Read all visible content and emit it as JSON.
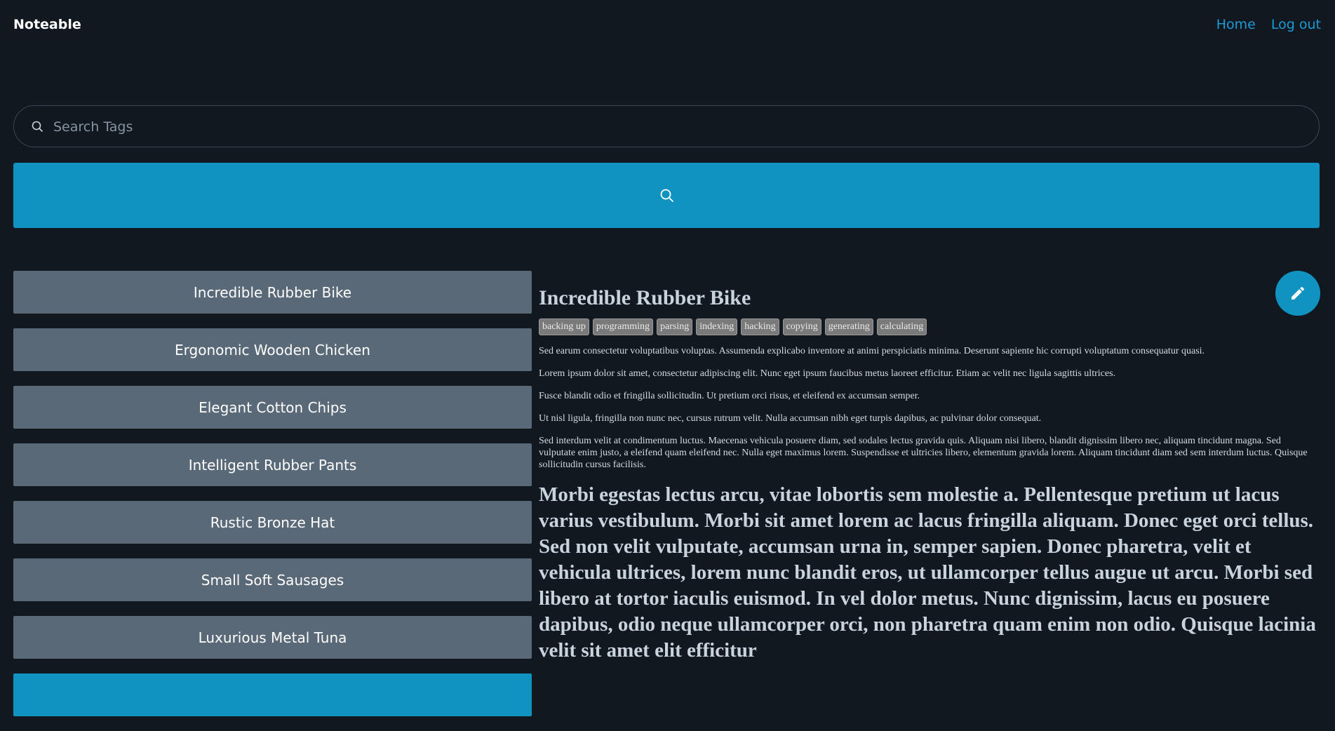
{
  "nav": {
    "brand": "Noteable",
    "home": "Home",
    "logout": "Log out"
  },
  "search": {
    "placeholder": "Search Tags",
    "value": ""
  },
  "notes": [
    "Incredible Rubber Bike",
    "Ergonomic Wooden Chicken",
    "Elegant Cotton Chips",
    "Intelligent Rubber Pants",
    "Rustic Bronze Hat",
    "Small Soft Sausages",
    "Luxurious Metal Tuna"
  ],
  "note": {
    "title": "Incredible Rubber Bike",
    "tags": [
      "backing up",
      "programming",
      "parsing",
      "indexing",
      "hacking",
      "copying",
      "generating",
      "calculating"
    ],
    "paragraphs": [
      "Sed earum consectetur voluptatibus voluptas. Assumenda explicabo inventore at animi perspiciatis minima. Deserunt sapiente hic corrupti voluptatum consequatur quasi.",
      "Lorem ipsum dolor sit amet, consectetur adipiscing elit. Nunc eget ipsum faucibus metus laoreet efficitur. Etiam ac velit nec ligula sagittis ultrices.",
      "Fusce blandit odio et fringilla sollicitudin. Ut pretium orci risus, et eleifend ex accumsan semper.",
      "Ut nisl ligula, fringilla non nunc nec, cursus rutrum velit. Nulla accumsan nibh eget turpis dapibus, ac pulvinar dolor consequat.",
      "Sed interdum velit at condimentum luctus. Maecenas vehicula posuere diam, sed sodales lectus gravida quis. Aliquam nisi libero, blandit dignissim libero nec, aliquam tincidunt magna. Sed vulputate enim justo, a eleifend quam eleifend nec. Nulla eget maximus lorem. Suspendisse et ultricies libero, elementum gravida lorem. Aliquam tincidunt diam sed sem interdum luctus. Quisque sollicitudin cursus facilisis."
    ],
    "heading": "Morbi egestas lectus arcu, vitae lobortis sem molestie a. Pellentesque pretium ut lacus varius vestibulum. Morbi sit amet lorem ac lacus fringilla aliquam. Donec eget orci tellus. Sed non velit vulputate, accumsan urna in, semper sapien. Donec pharetra, velit et vehicula ultrices, lorem nunc blandit eros, ut ullamcorper tellus augue ut arcu. Morbi sed libero at tortor iaculis euismod. In vel dolor metus. Nunc dignissim, lacus eu posuere dapibus, odio neque ullamcorper orci, non pharetra quam enim non odio. Quisque lacinia velit sit amet elit efficitur"
  },
  "icons": {
    "search": "search-icon",
    "edit": "pencil-icon"
  },
  "colors": {
    "background": "#111820",
    "accent": "#1193c1",
    "link": "#1e9ad6",
    "note_item": "#5a6978"
  }
}
